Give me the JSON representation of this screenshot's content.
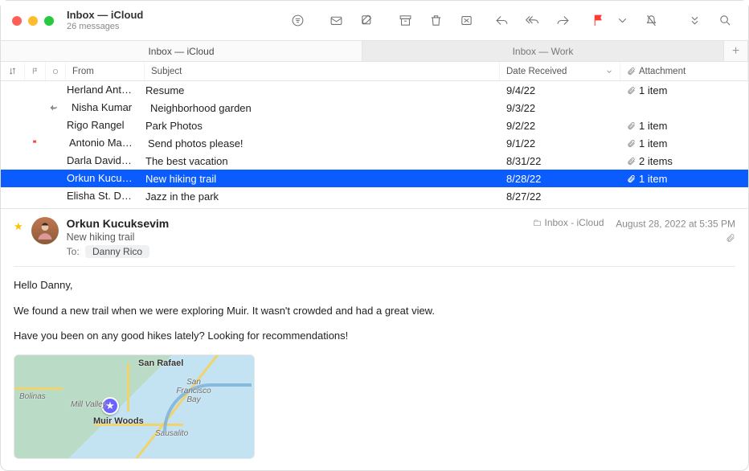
{
  "header": {
    "title": "Inbox — iCloud",
    "subtitle": "26 messages"
  },
  "tabs": [
    {
      "label": "Inbox — iCloud",
      "active": true
    },
    {
      "label": "Inbox — Work",
      "active": false
    }
  ],
  "columns": {
    "from": "From",
    "subject": "Subject",
    "date": "Date Received",
    "attachment": "Attachment"
  },
  "messages": [
    {
      "from": "Herland Ante...",
      "subject": "Resume",
      "date": "9/4/22",
      "attachment": "1 item",
      "flag": false,
      "reply": false
    },
    {
      "from": "Nisha Kumar",
      "subject": "Neighborhood garden",
      "date": "9/3/22",
      "attachment": "",
      "flag": false,
      "reply": true
    },
    {
      "from": "Rigo Rangel",
      "subject": "Park Photos",
      "date": "9/2/22",
      "attachment": "1 item",
      "flag": false,
      "reply": false
    },
    {
      "from": "Antonio Manri...",
      "subject": "Send photos please!",
      "date": "9/1/22",
      "attachment": "1 item",
      "flag": true,
      "reply": false
    },
    {
      "from": "Darla Davidson",
      "subject": "The best vacation",
      "date": "8/31/22",
      "attachment": "2 items",
      "flag": false,
      "reply": false
    },
    {
      "from": "Orkun Kucuks...",
      "subject": "New hiking trail",
      "date": "8/28/22",
      "attachment": "1 item",
      "flag": false,
      "reply": false,
      "selected": true
    },
    {
      "from": "Elisha St. Denis",
      "subject": "Jazz in the park",
      "date": "8/27/22",
      "attachment": "",
      "flag": false,
      "reply": false
    }
  ],
  "preview": {
    "sender": "Orkun Kucuksevim",
    "subject": "New hiking trail",
    "to_label": "To:",
    "recipient": "Danny Rico",
    "folder": "Inbox - iCloud",
    "datetime": "August 28, 2022 at 5:35 PM",
    "paragraphs": [
      "Hello Danny,",
      "We found a new trail when we were exploring Muir. It wasn't crowded and had a great view.",
      "Have you been on any good hikes lately? Looking for recommendations!"
    ],
    "map": {
      "pin_label": "Muir Woods",
      "labels": [
        "San Rafael",
        "Mill Valley",
        "Bolinas",
        "Sausalito",
        "San Francisco Bay"
      ]
    }
  }
}
